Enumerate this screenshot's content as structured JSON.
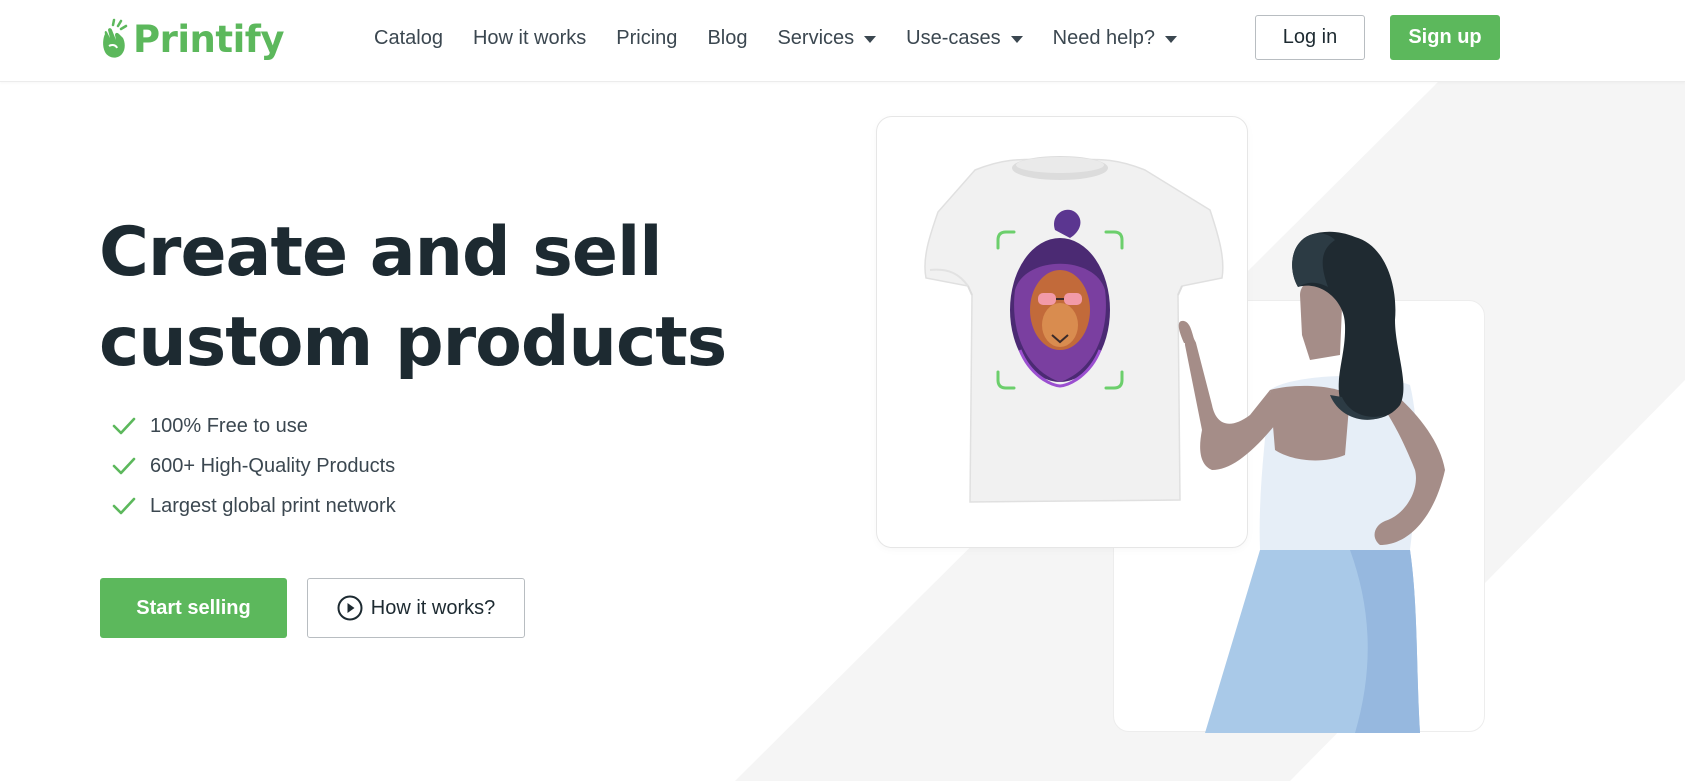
{
  "brand": {
    "name": "Printify",
    "color": "#5cb85c"
  },
  "nav": {
    "items": [
      {
        "label": "Catalog",
        "dropdown": false
      },
      {
        "label": "How it works",
        "dropdown": false
      },
      {
        "label": "Pricing",
        "dropdown": false
      },
      {
        "label": "Blog",
        "dropdown": false
      },
      {
        "label": "Services",
        "dropdown": true
      },
      {
        "label": "Use-cases",
        "dropdown": true
      },
      {
        "label": "Need help?",
        "dropdown": true
      }
    ],
    "login_label": "Log in",
    "signup_label": "Sign up"
  },
  "hero": {
    "title_line1": "Create and sell",
    "title_line2": "custom products",
    "benefits": [
      "100% Free to use",
      "600+ High-Quality Products",
      "Largest global print network"
    ],
    "cta_primary": "Start selling",
    "cta_secondary": "How it works?"
  },
  "icons": {
    "logo": "printify-hand-logo-icon",
    "caret": "chevron-down-icon",
    "check": "check-icon",
    "play": "play-circle-icon"
  },
  "colors": {
    "accent": "#5cb85c",
    "text_dark": "#1d2a31",
    "text_body": "#3b4750",
    "background_band": "#f5f5f5",
    "skirt": "#a9c9e8"
  }
}
